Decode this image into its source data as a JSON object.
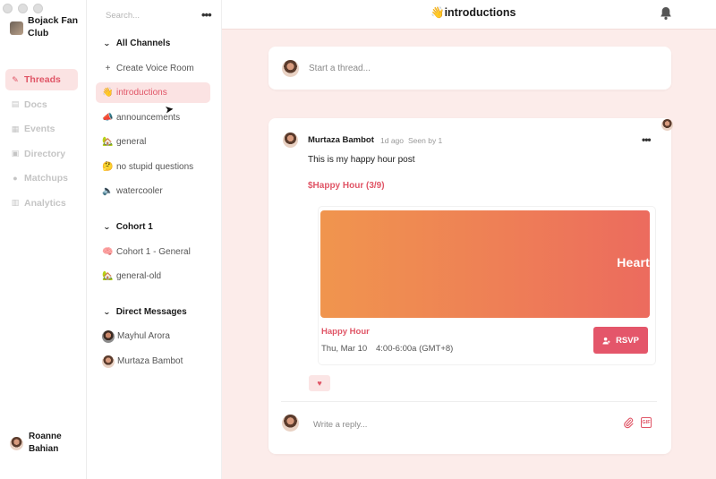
{
  "community": {
    "name": "Bojack Fan Club"
  },
  "rail": {
    "items": [
      {
        "label": "Threads",
        "icon": "pencil-icon",
        "glyph": "✎",
        "active": true
      },
      {
        "label": "Docs",
        "icon": "doc-icon",
        "glyph": "▤",
        "active": false
      },
      {
        "label": "Events",
        "icon": "calendar-icon",
        "glyph": "▦",
        "active": false
      },
      {
        "label": "Directory",
        "icon": "directory-icon",
        "glyph": "▣",
        "active": false
      },
      {
        "label": "Matchups",
        "icon": "people-icon",
        "glyph": "●",
        "active": false
      },
      {
        "label": "Analytics",
        "icon": "chart-icon",
        "glyph": "▥",
        "active": false
      }
    ]
  },
  "user": {
    "name": "Roanne Bahian"
  },
  "sidebar": {
    "search_placeholder": "Search...",
    "groups": {
      "all_channels": "All Channels",
      "cohort": "Cohort 1",
      "dms": "Direct Messages"
    },
    "create_voice_room": "Create Voice Room",
    "channels": [
      {
        "emoji": "👋",
        "label": "introductions",
        "active": true
      },
      {
        "emoji": "📣",
        "label": "announcements",
        "active": false
      },
      {
        "emoji": "🏡",
        "label": "general",
        "active": false
      },
      {
        "emoji": "🤔",
        "label": "no stupid questions",
        "active": false
      },
      {
        "emoji": "🔈",
        "label": "watercooler",
        "active": false
      }
    ],
    "cohort_channels": [
      {
        "emoji": "🧠",
        "label": "Cohort 1 - General"
      },
      {
        "emoji": "🏡",
        "label": "general-old"
      }
    ],
    "direct_messages": [
      {
        "label": "Mayhul Arora"
      },
      {
        "label": "Murtaza Bambot"
      }
    ]
  },
  "header": {
    "title": "introductions",
    "emoji": "👋"
  },
  "composer": {
    "placeholder": "Start a thread..."
  },
  "post": {
    "author": "Murtaza Bambot",
    "time_ago": "1d ago",
    "seen": "Seen by 1",
    "body": "This is my happy hour post",
    "event_link": "$Happy Hour (3/9)",
    "event": {
      "banner_text": "Heart",
      "name": "Happy Hour",
      "date": "Thu, Mar 10",
      "time": "4:00-6:00a (GMT+8)",
      "rsvp_label": "RSVP"
    },
    "reply_placeholder": "Write a reply...",
    "gif_label": "GIF"
  },
  "colors": {
    "accent": "#e05566",
    "rsvp": "#e4566a",
    "active_bg": "#fbe3e3",
    "main_bg": "#fcecea"
  }
}
